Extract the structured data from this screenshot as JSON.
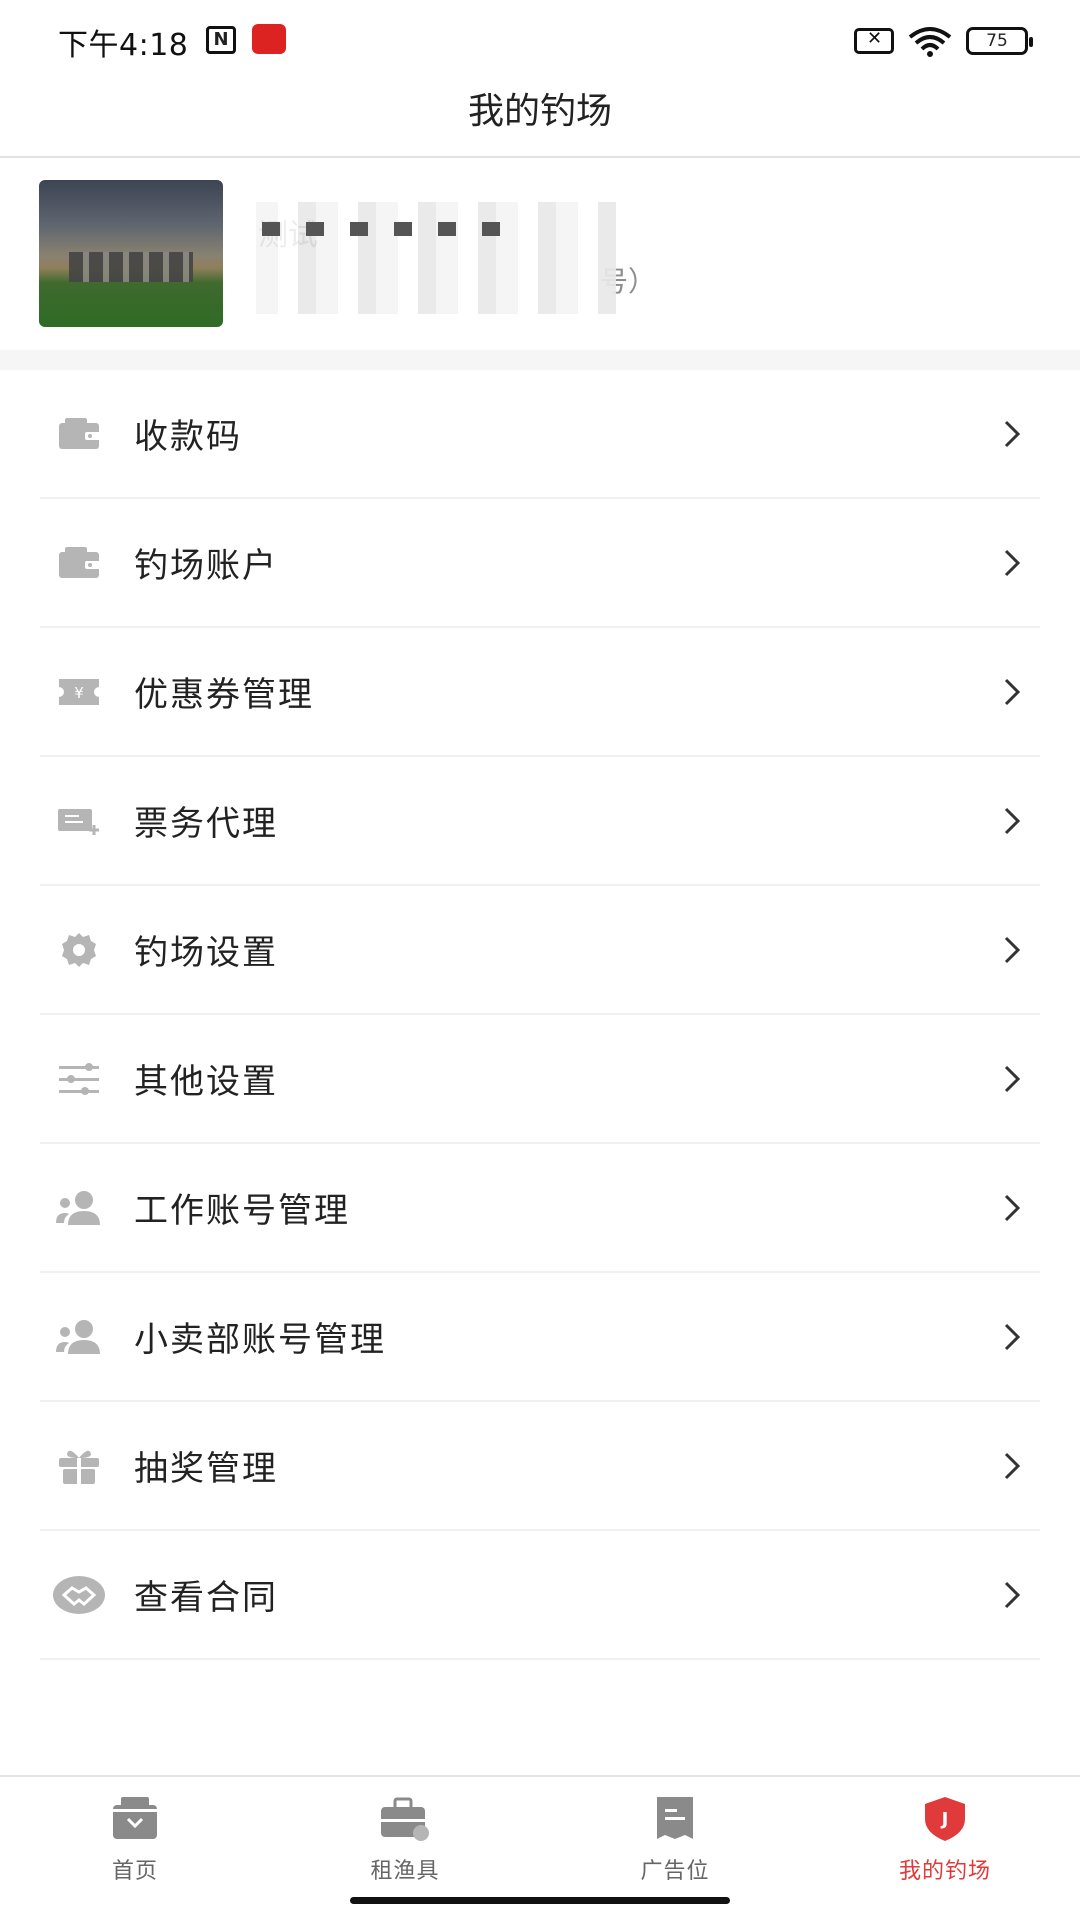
{
  "status_bar": {
    "time": "下午4:18",
    "nfc_glyph": "N",
    "battery": "75"
  },
  "header": {
    "title": "我的钓场"
  },
  "profile": {
    "name": "测试",
    "sub": "号）"
  },
  "menu": {
    "items": [
      {
        "label": "收款码",
        "icon": "wallet-icon"
      },
      {
        "label": "钓场账户",
        "icon": "wallet-icon"
      },
      {
        "label": "优惠券管理",
        "icon": "coupon-icon"
      },
      {
        "label": "票务代理",
        "icon": "agent-ticket-icon"
      },
      {
        "label": "钓场设置",
        "icon": "gear-icon"
      },
      {
        "label": "其他设置",
        "icon": "sliders-icon"
      },
      {
        "label": "工作账号管理",
        "icon": "users-icon"
      },
      {
        "label": "小卖部账号管理",
        "icon": "users-icon"
      },
      {
        "label": "抽奖管理",
        "icon": "gift-icon"
      },
      {
        "label": "查看合同",
        "icon": "handshake-icon"
      }
    ]
  },
  "tabbar": {
    "tabs": [
      {
        "label": "首页",
        "icon": "home-box-icon"
      },
      {
        "label": "租渔具",
        "icon": "toolbox-icon"
      },
      {
        "label": "广告位",
        "icon": "ad-board-icon"
      },
      {
        "label": "我的钓场",
        "icon": "shield-j-icon",
        "active": true
      }
    ]
  },
  "colors": {
    "accent": "#e03a3a",
    "icon_gray": "#b5b5b5"
  }
}
